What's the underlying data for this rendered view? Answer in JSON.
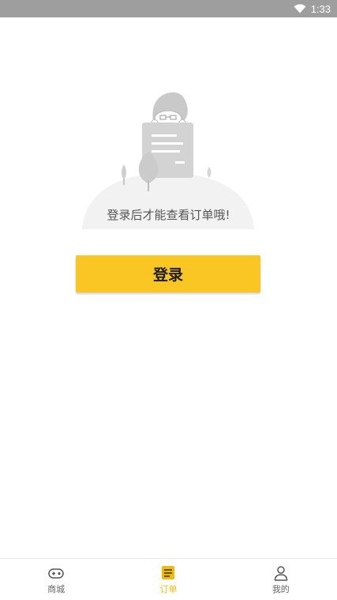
{
  "status_bar": {
    "time": "1:33",
    "background": "#9e9e9e"
  },
  "empty_state": {
    "message": "登录后才能查看订单哦!",
    "illustration": "person-with-document"
  },
  "login_button": {
    "label": "登录",
    "background": "#f9c623"
  },
  "bottom_nav": {
    "active_color": "#f0b90b",
    "inactive_color": "#666666",
    "items": [
      {
        "label": "商城",
        "icon": "gamepad-icon",
        "active": false
      },
      {
        "label": "订单",
        "icon": "order-list-icon",
        "active": true
      },
      {
        "label": "我的",
        "icon": "user-icon",
        "active": false
      }
    ]
  }
}
